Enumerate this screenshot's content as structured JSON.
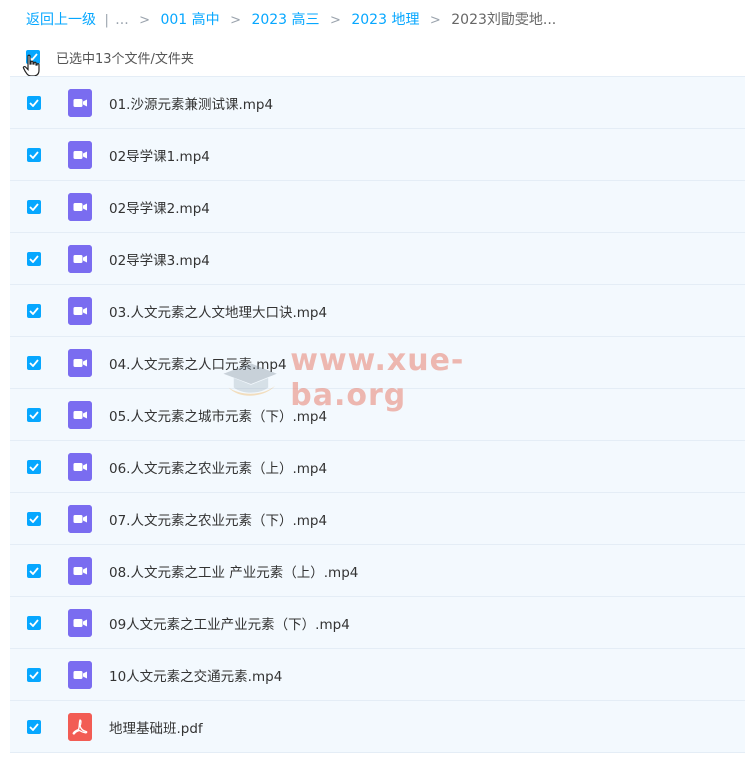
{
  "breadcrumb": {
    "back": "返回上一级",
    "sep_pipe": "|",
    "ellipsis": "...",
    "items": [
      "001 高中",
      "2023 高三",
      "2023 地理"
    ],
    "current": "2023刘勖雯地..."
  },
  "selection": {
    "text": "已选中13个文件/文件夹"
  },
  "files": [
    {
      "name": "01.沙源元素兼测试课.mp4",
      "type": "video"
    },
    {
      "name": "02导学课1.mp4",
      "type": "video"
    },
    {
      "name": "02导学课2.mp4",
      "type": "video"
    },
    {
      "name": "02导学课3.mp4",
      "type": "video"
    },
    {
      "name": "03.人文元素之人文地理大口诀.mp4",
      "type": "video"
    },
    {
      "name": "04.人文元素之人口元素.mp4",
      "type": "video"
    },
    {
      "name": "05.人文元素之城市元素（下）.mp4",
      "type": "video"
    },
    {
      "name": "06.人文元素之农业元素（上）.mp4",
      "type": "video"
    },
    {
      "name": "07.人文元素之农业元素（下）.mp4",
      "type": "video"
    },
    {
      "name": "08.人文元素之工业 产业元素（上）.mp4",
      "type": "video"
    },
    {
      "name": "09人文元素之工业产业元素（下）.mp4",
      "type": "video"
    },
    {
      "name": "10人文元素之交通元素.mp4",
      "type": "video"
    },
    {
      "name": "地理基础班.pdf",
      "type": "pdf"
    }
  ],
  "watermark": {
    "text": "www.xue-ba.org"
  },
  "colors": {
    "accent": "#06a7ff",
    "video_icon": "#7a6cf0",
    "pdf_icon": "#f25c54",
    "row_bg": "#f3f9fe"
  }
}
